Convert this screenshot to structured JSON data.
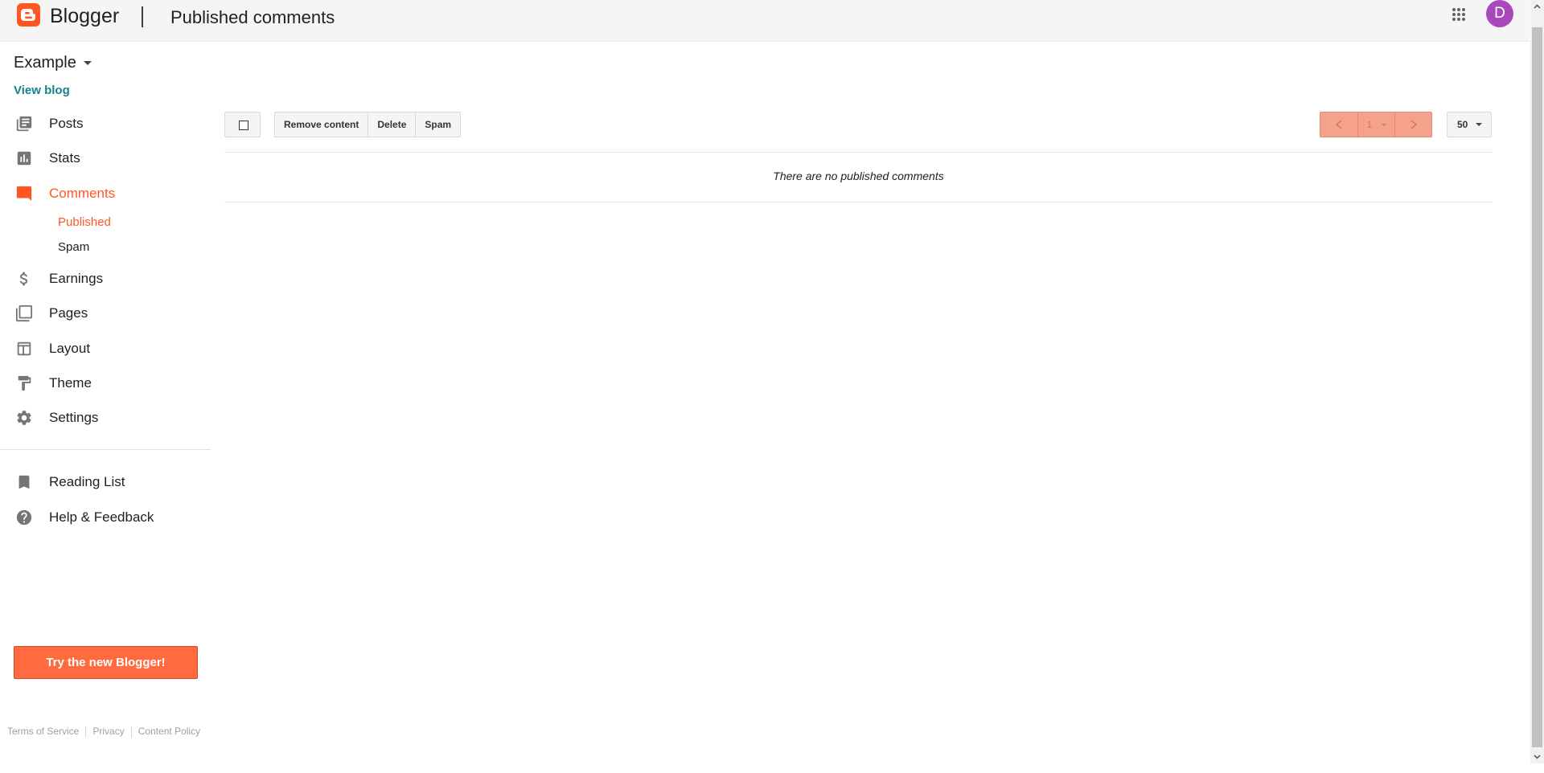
{
  "header": {
    "brand": "Blogger",
    "title": "Published comments",
    "avatar_letter": "D",
    "brand_color": "#ff5722",
    "avatar_color": "#ab47bc"
  },
  "sidebar": {
    "blog_name": "Example",
    "view_blog": "View blog",
    "items": [
      {
        "label": "Posts",
        "icon": "posts-icon"
      },
      {
        "label": "Stats",
        "icon": "stats-icon"
      },
      {
        "label": "Comments",
        "icon": "comments-icon",
        "active": true
      },
      {
        "label": "Earnings",
        "icon": "dollar-icon"
      },
      {
        "label": "Pages",
        "icon": "pages-icon"
      },
      {
        "label": "Layout",
        "icon": "layout-icon"
      },
      {
        "label": "Theme",
        "icon": "paint-roller-icon"
      },
      {
        "label": "Settings",
        "icon": "gear-icon"
      }
    ],
    "comments_sub": [
      {
        "label": "Published",
        "active": true
      },
      {
        "label": "Spam"
      }
    ],
    "secondary_items": [
      {
        "label": "Reading List",
        "icon": "bookmark-icon"
      },
      {
        "label": "Help & Feedback",
        "icon": "help-icon"
      }
    ],
    "try_button": "Try the new Blogger!",
    "footer": {
      "terms": "Terms of Service",
      "privacy": "Privacy",
      "content_policy": "Content Policy"
    }
  },
  "toolbar": {
    "remove_content": "Remove content",
    "delete": "Delete",
    "spam": "Spam",
    "page_number": "1",
    "per_page": "50"
  },
  "main": {
    "empty_message": "There are no published comments"
  }
}
